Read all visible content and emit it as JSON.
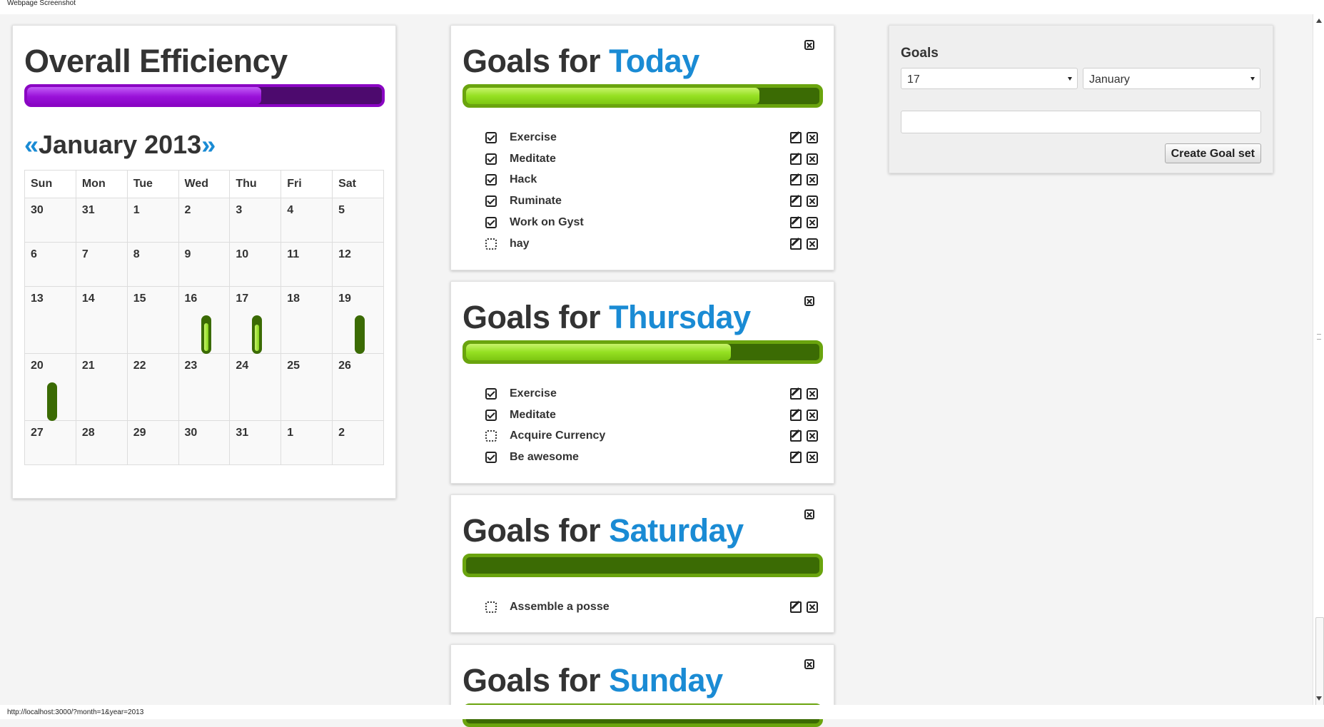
{
  "window": {
    "title": "Webpage Screenshot",
    "status_url": "http://localhost:3000/?month=1&year=2013"
  },
  "efficiency": {
    "title": "Overall Efficiency",
    "progress_pct": 66
  },
  "calendar": {
    "prev": "«",
    "next": "»",
    "month_label": "January 2013",
    "weekdays": [
      "Sun",
      "Mon",
      "Tue",
      "Wed",
      "Thu",
      "Fri",
      "Sat"
    ],
    "weeks": [
      [
        "30",
        "31",
        "1",
        "2",
        "3",
        "4",
        "5"
      ],
      [
        "6",
        "7",
        "8",
        "9",
        "10",
        "11",
        "12"
      ],
      [
        "13",
        "14",
        "15",
        "16",
        "17",
        "18",
        "19"
      ],
      [
        "20",
        "21",
        "22",
        "23",
        "24",
        "25",
        "26"
      ],
      [
        "27",
        "28",
        "29",
        "30",
        "31",
        "1",
        "2"
      ]
    ],
    "day_progress": [
      {
        "week": 2,
        "dow": 3,
        "fraction": 0.85
      },
      {
        "week": 2,
        "dow": 4,
        "fraction": 0.8
      },
      {
        "week": 2,
        "dow": 6,
        "fraction": 0.0
      },
      {
        "week": 3,
        "dow": 0,
        "fraction": 0.0
      }
    ]
  },
  "goal_sets": [
    {
      "prefix": "Goals for",
      "day": "Today",
      "progress_pct": 83,
      "goals": [
        {
          "label": "Exercise",
          "done": true
        },
        {
          "label": "Meditate",
          "done": true
        },
        {
          "label": "Hack",
          "done": true
        },
        {
          "label": "Ruminate",
          "done": true
        },
        {
          "label": "Work on Gyst",
          "done": true
        },
        {
          "label": "hay",
          "done": false
        }
      ]
    },
    {
      "prefix": "Goals for",
      "day": "Thursday",
      "progress_pct": 75,
      "goals": [
        {
          "label": "Exercise",
          "done": true
        },
        {
          "label": "Meditate",
          "done": true
        },
        {
          "label": "Acquire Currency",
          "done": false
        },
        {
          "label": "Be awesome",
          "done": true
        }
      ]
    },
    {
      "prefix": "Goals for",
      "day": "Saturday",
      "progress_pct": 0,
      "goals": [
        {
          "label": "Assemble a posse",
          "done": false
        }
      ]
    },
    {
      "prefix": "Goals for",
      "day": "Sunday",
      "progress_pct": 0,
      "goals": []
    }
  ],
  "goal_form": {
    "title": "Goals",
    "day_value": "17",
    "month_value": "January",
    "goal_input_value": "",
    "submit_label": "Create Goal set"
  }
}
